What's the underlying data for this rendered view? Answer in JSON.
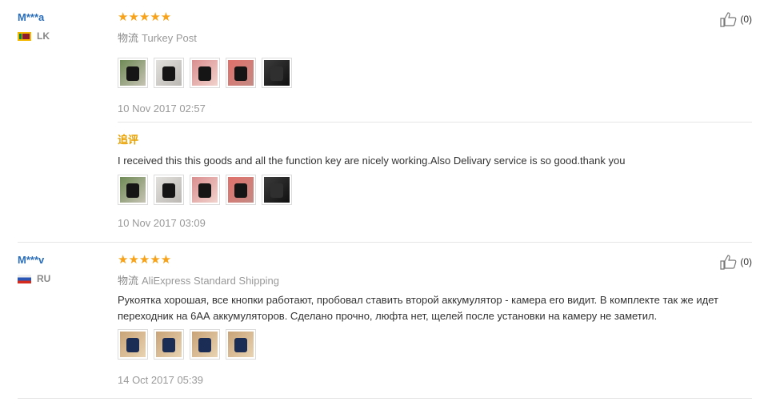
{
  "reviews": [
    {
      "user": "M***a",
      "country": "LK",
      "stars": "★★★★★",
      "shipping_label": "物流",
      "shipping": "Turkey Post",
      "helpful": "(0)",
      "photos": [
        "green",
        "grey",
        "pink",
        "red",
        "dark"
      ],
      "date": "10 Nov 2017 02:57",
      "followup": {
        "label": "追评",
        "text": "I received this this goods and all the function key are nicely working.Also Delivary service is so good.thank you",
        "photos": [
          "green",
          "grey",
          "pink",
          "red",
          "dark"
        ],
        "date": "10 Nov 2017 03:09"
      }
    },
    {
      "user": "M***v",
      "country": "RU",
      "stars": "★★★★★",
      "shipping_label": "物流",
      "shipping": "AliExpress Standard Shipping",
      "helpful": "(0)",
      "text": "Рукоятка хорошая, все кнопки работают, пробовал ставить второй аккумулятор - камера его видит. В комплекте так же идет переходник на 6АА аккумуляторов. Сделано прочно, люфта нет, щелей после установки на камеру не заметил.",
      "photos": [
        "tan",
        "tan",
        "tan",
        "tan"
      ],
      "date": "14 Oct 2017 05:39"
    }
  ]
}
